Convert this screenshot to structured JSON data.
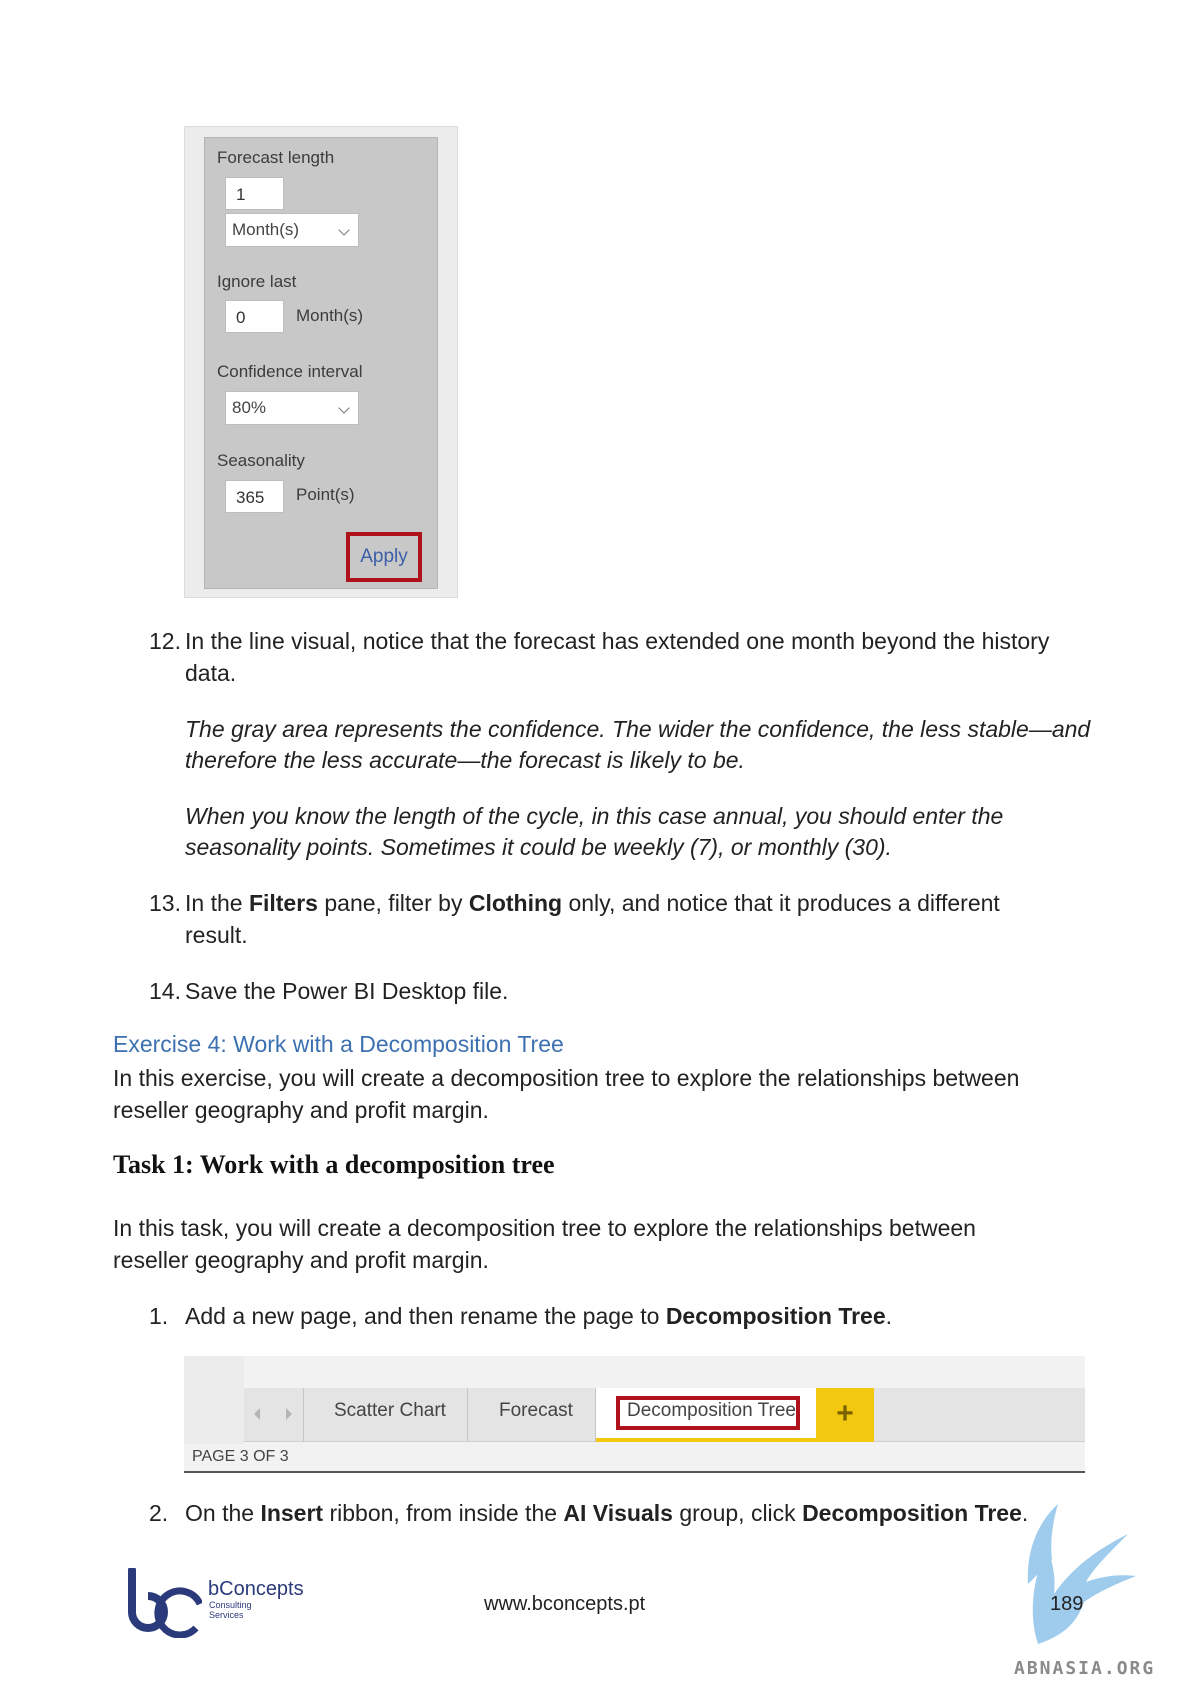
{
  "forecast_panel": {
    "length_label": "Forecast length",
    "length_value": "1",
    "length_unit": "Month(s)",
    "ignore_label": "Ignore last",
    "ignore_value": "0",
    "ignore_unit": "Month(s)",
    "confidence_label": "Confidence interval",
    "confidence_value": "80%",
    "seasonality_label": "Seasonality",
    "seasonality_value": "365",
    "seasonality_unit": "Point(s)",
    "apply_label": "Apply"
  },
  "step12": {
    "number": "12.",
    "line1": "In the line visual, notice that the forecast has extended one month beyond the history",
    "line2": "data.",
    "note1_line1": "The gray area represents the confidence. The wider the confidence, the less stable—and",
    "note1_line2": "therefore the less accurate—the forecast is likely to be.",
    "note2_line1": "When you know the length of the cycle, in this case annual, you should enter the",
    "note2_line2": "seasonality points. Sometimes it could be weekly (7), or monthly (30)."
  },
  "step13": {
    "number": "13.",
    "t1": "In the ",
    "b1": "Filters",
    "t2": " pane, filter by ",
    "b2": "Clothing",
    "t3": " only, and notice that it produces a different",
    "line2": "result."
  },
  "step14": {
    "number": "14.",
    "text": "Save the Power BI Desktop file."
  },
  "exercise": {
    "heading": "Exercise 4: Work with a Decomposition Tree",
    "intro_line1": "In this exercise, you will create a decomposition tree to explore the relationships between",
    "intro_line2": "reseller geography and profit margin."
  },
  "task": {
    "heading": "Task 1: Work with a decomposition tree",
    "intro_line1": "In this task, you will create a decomposition tree to explore the relationships between",
    "intro_line2": "reseller geography and profit margin."
  },
  "task_step1": {
    "number": "1.",
    "t1": "Add a new page, and then rename the page to ",
    "b1": "Decomposition Tree",
    "t2": "."
  },
  "tabs": {
    "tab1": "Scatter Chart",
    "tab2": "Forecast",
    "tab3": "Decomposition Tree",
    "add": "+",
    "page_count": "PAGE 3 OF 3"
  },
  "task_step2": {
    "number": "2.",
    "t1": "On the ",
    "b1": "Insert",
    "t2": " ribbon, from inside the ",
    "b2": "AI Visuals",
    "t3": " group, click ",
    "b3": "Decomposition Tree",
    "t4": "."
  },
  "footer": {
    "company": "bConcepts",
    "company_sub1": "Consulting",
    "company_sub2": "Services",
    "url": "www.bconcepts.pt",
    "page_number": "189",
    "watermark": "ABNASIA.ORG"
  },
  "colors": {
    "highlight_red": "#b0121c",
    "tab_yellow": "#f2c811",
    "heading_blue": "#3c70b0",
    "logo_navy": "#2b3a7a"
  }
}
